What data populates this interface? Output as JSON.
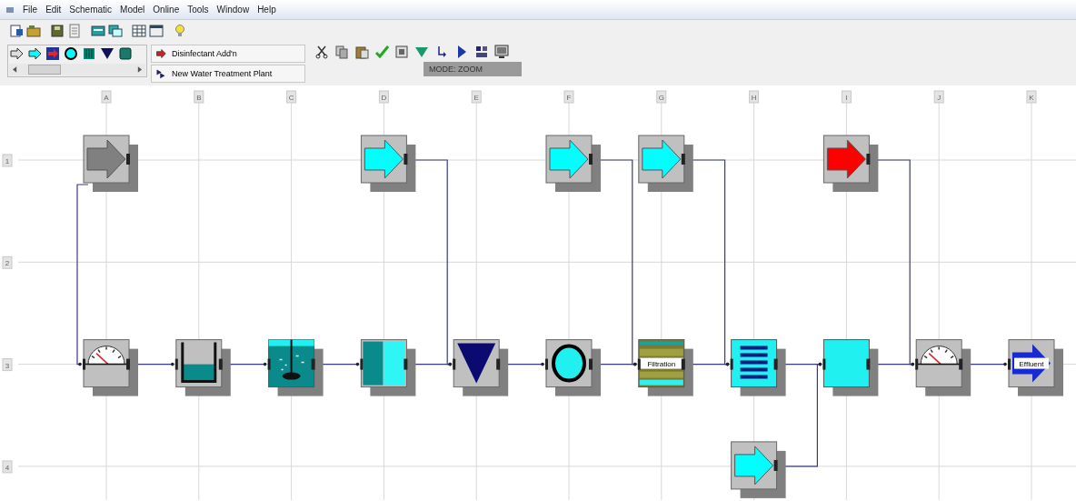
{
  "menu": [
    "File",
    "Edit",
    "Schematic",
    "Model",
    "Online",
    "Tools",
    "Window",
    "Help"
  ],
  "unit_list": [
    {
      "label": "Disinfectant Add'n"
    },
    {
      "label": "New Water Treatment Plant"
    }
  ],
  "mode": "MODE: ZOOM",
  "grid": {
    "columns": [
      "A",
      "B",
      "C",
      "D",
      "E",
      "F",
      "G",
      "H",
      "I",
      "J",
      "K"
    ],
    "rows": [
      {
        "label": "1",
        "cells": [
          {
            "kind": "arrow",
            "color": "#808080",
            "link": {
              "kind": "same-column"
            }
          },
          {
            "kind": "empty"
          },
          {
            "kind": "empty"
          },
          {
            "kind": "arrow",
            "color": "#00ffff",
            "link": {
              "kind": "next-column"
            }
          },
          {
            "kind": "empty"
          },
          {
            "kind": "arrow",
            "color": "#00ffff",
            "link": {
              "kind": "next-column"
            }
          },
          {
            "kind": "arrow",
            "color": "#00ffff",
            "link": {
              "kind": "next-column"
            }
          },
          {
            "kind": "empty"
          },
          {
            "kind": "arrow",
            "color": "#ff0000",
            "link": {
              "kind": "next-column"
            }
          },
          {
            "kind": "empty"
          },
          {
            "kind": "empty"
          }
        ]
      },
      {
        "label": "2",
        "cells": []
      },
      {
        "label": "3",
        "cells": [
          {
            "kind": "gauge",
            "link": {
              "kind": "right"
            }
          },
          {
            "kind": "tank",
            "link": {
              "kind": "right"
            }
          },
          {
            "kind": "mixer",
            "link": {
              "kind": "right"
            }
          },
          {
            "kind": "split",
            "link": {
              "kind": "right"
            }
          },
          {
            "kind": "triangle",
            "link": {
              "kind": "right"
            }
          },
          {
            "kind": "circle",
            "link": {
              "kind": "right"
            }
          },
          {
            "kind": "filter",
            "label": "Filtration",
            "link": {
              "kind": "right"
            }
          },
          {
            "kind": "lines",
            "link": {
              "kind": "right"
            }
          },
          {
            "kind": "square",
            "link": {
              "kind": "right"
            }
          },
          {
            "kind": "gauge",
            "link": {
              "kind": "right"
            }
          },
          {
            "kind": "effluent",
            "label": "Effluent"
          }
        ]
      },
      {
        "label": "4",
        "cells": [
          {
            "kind": "empty"
          },
          {
            "kind": "empty"
          },
          {
            "kind": "empty"
          },
          {
            "kind": "empty"
          },
          {
            "kind": "empty"
          },
          {
            "kind": "empty"
          },
          {
            "kind": "empty"
          },
          {
            "kind": "arrow",
            "color": "#00ffff",
            "link": {
              "kind": "next-column"
            }
          },
          {
            "kind": "empty"
          },
          {
            "kind": "empty"
          },
          {
            "kind": "empty"
          }
        ]
      }
    ]
  }
}
